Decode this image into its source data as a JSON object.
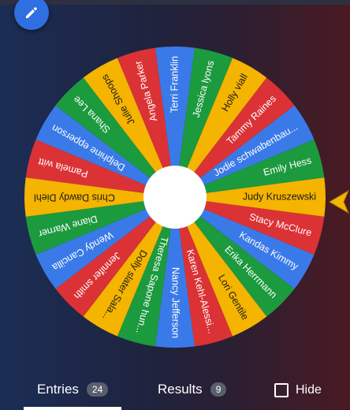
{
  "colors": {
    "red": "#db3236",
    "blue": "#3a7ae8",
    "green": "#1c9a3e",
    "yellow": "#f4b400",
    "hub": "#ffffff",
    "pointer": "#f4b400"
  },
  "edit_button": {
    "icon": "pencil-icon"
  },
  "wheel": {
    "entries": [
      "Judy Kruszewski",
      "Stacy McClure",
      "Kandas Kimmy",
      "Erika Herrmann",
      "Lori Gentile",
      "Karen Kehl-Alessi...",
      "Nancy Jefferson",
      "Theresa Sapone hun...",
      "Dolly slater Sala...",
      "Jennifer smith",
      "Wendy Cancilla",
      "Diane Warner",
      "Chris Dawdy Diehl",
      "Pamela witt",
      "Delphine epperson",
      "Shana Lee",
      "Julie Shoops",
      "Angela Parker",
      "Terri Franklin",
      "Jessica lyons",
      "Holly viall",
      "Tammy Raines",
      "Jodie schwabenbau...",
      "Emily Hess"
    ],
    "slice_colors": [
      "yellow",
      "red",
      "blue",
      "green",
      "yellow",
      "red",
      "blue",
      "green",
      "yellow",
      "red",
      "blue",
      "green",
      "yellow",
      "red",
      "blue",
      "green",
      "yellow",
      "red",
      "blue",
      "green",
      "yellow",
      "red",
      "blue",
      "green"
    ]
  },
  "tabs": {
    "entries": {
      "label": "Entries",
      "count": "24"
    },
    "results": {
      "label": "Results",
      "count": "9"
    }
  },
  "hide": {
    "label": "Hide",
    "checked": false
  }
}
